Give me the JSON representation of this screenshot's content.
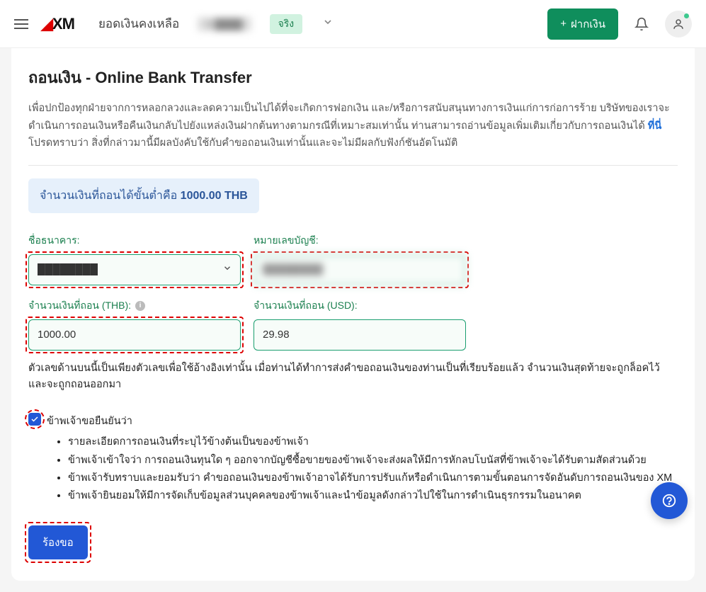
{
  "topbar": {
    "balance_label": "ยอดเงินคงเหลือ",
    "balance_value": "$ ████",
    "real_badge": "จริง",
    "deposit_label": "ฝากเงิน"
  },
  "page": {
    "title": "ถอนเงิน - Online Bank Transfer",
    "description_1": "เพื่อปกป้องทุกฝ่ายจากการหลอกลวงและลดความเป็นไปได้ที่จะเกิดการฟอกเงิน และ/หรือการสนับสนุนทางการเงินแก่การก่อการร้าย บริษัทของเราจะดำเนินการถอนเงินหรือคืนเงินกลับไปยังแหล่งเงินฝากต้นทางตามกรณีที่เหมาะสมเท่านั้น ท่านสามารถอ่านข้อมูลเพิ่มเติมเกี่ยวกับการถอนเงินได้ ",
    "here_link": "ที่นี่",
    "description_2": " โปรดทราบว่า สิ่งที่กล่าวมานี้มีผลบังคับใช้กับคำขอถอนเงินเท่านั้นและจะไม่มีผลกับฟังก์ชันอัตโนมัติ",
    "min_prefix": "จำนวนเงินที่ถอนได้ขั้นต่ำคือ ",
    "min_value": "1000.00 THB"
  },
  "form": {
    "bank_label": "ชื่อธนาคาร:",
    "bank_value": "████████",
    "account_label": "หมายเลขบัญชี:",
    "account_value": "████████",
    "amount_thb_label": "จำนวนเงินที่ถอน (THB):",
    "amount_thb_value": "1000.00",
    "amount_usd_label": "จำนวนเงินที่ถอน (USD):",
    "amount_usd_value": "29.98",
    "note": "ตัวเลขด้านบนนี้เป็นเพียงตัวเลขเพื่อใช้อ้างอิงเท่านั้น เมื่อท่านได้ทำการส่งคำขอถอนเงินของท่านเป็นที่เรียบร้อยแล้ว จำนวนเงินสุดท้ายจะถูกล็อคไว้และจะถูกถอนออกมา"
  },
  "confirm": {
    "intro": "ข้าพเจ้าขอยืนยันว่า",
    "bullets": [
      "รายละเอียดการถอนเงินที่ระบุไว้ข้างต้นเป็นของข้าพเจ้า",
      "ข้าพเจ้าเข้าใจว่า การถอนเงินทุนใด ๆ ออกจากบัญชีซื้อขายของข้าพเจ้าจะส่งผลให้มีการหักลบโบนัสที่ข้าพเจ้าจะได้รับตามสัดส่วนด้วย",
      "ข้าพเจ้ารับทราบและยอมรับว่า คำขอถอนเงินของข้าพเจ้าอาจได้รับการปรับแก้หรือดำเนินการตามขั้นตอนการจัดอันดับการถอนเงินของ XM",
      "ข้าพเจ้ายินยอมให้มีการจัดเก็บข้อมูลส่วนบุคคลของข้าพเจ้าและนำข้อมูลดังกล่าวไปใช้ในการดำเนินธุรกรรมในอนาคต"
    ]
  },
  "submit_label": "ร้องขอ"
}
